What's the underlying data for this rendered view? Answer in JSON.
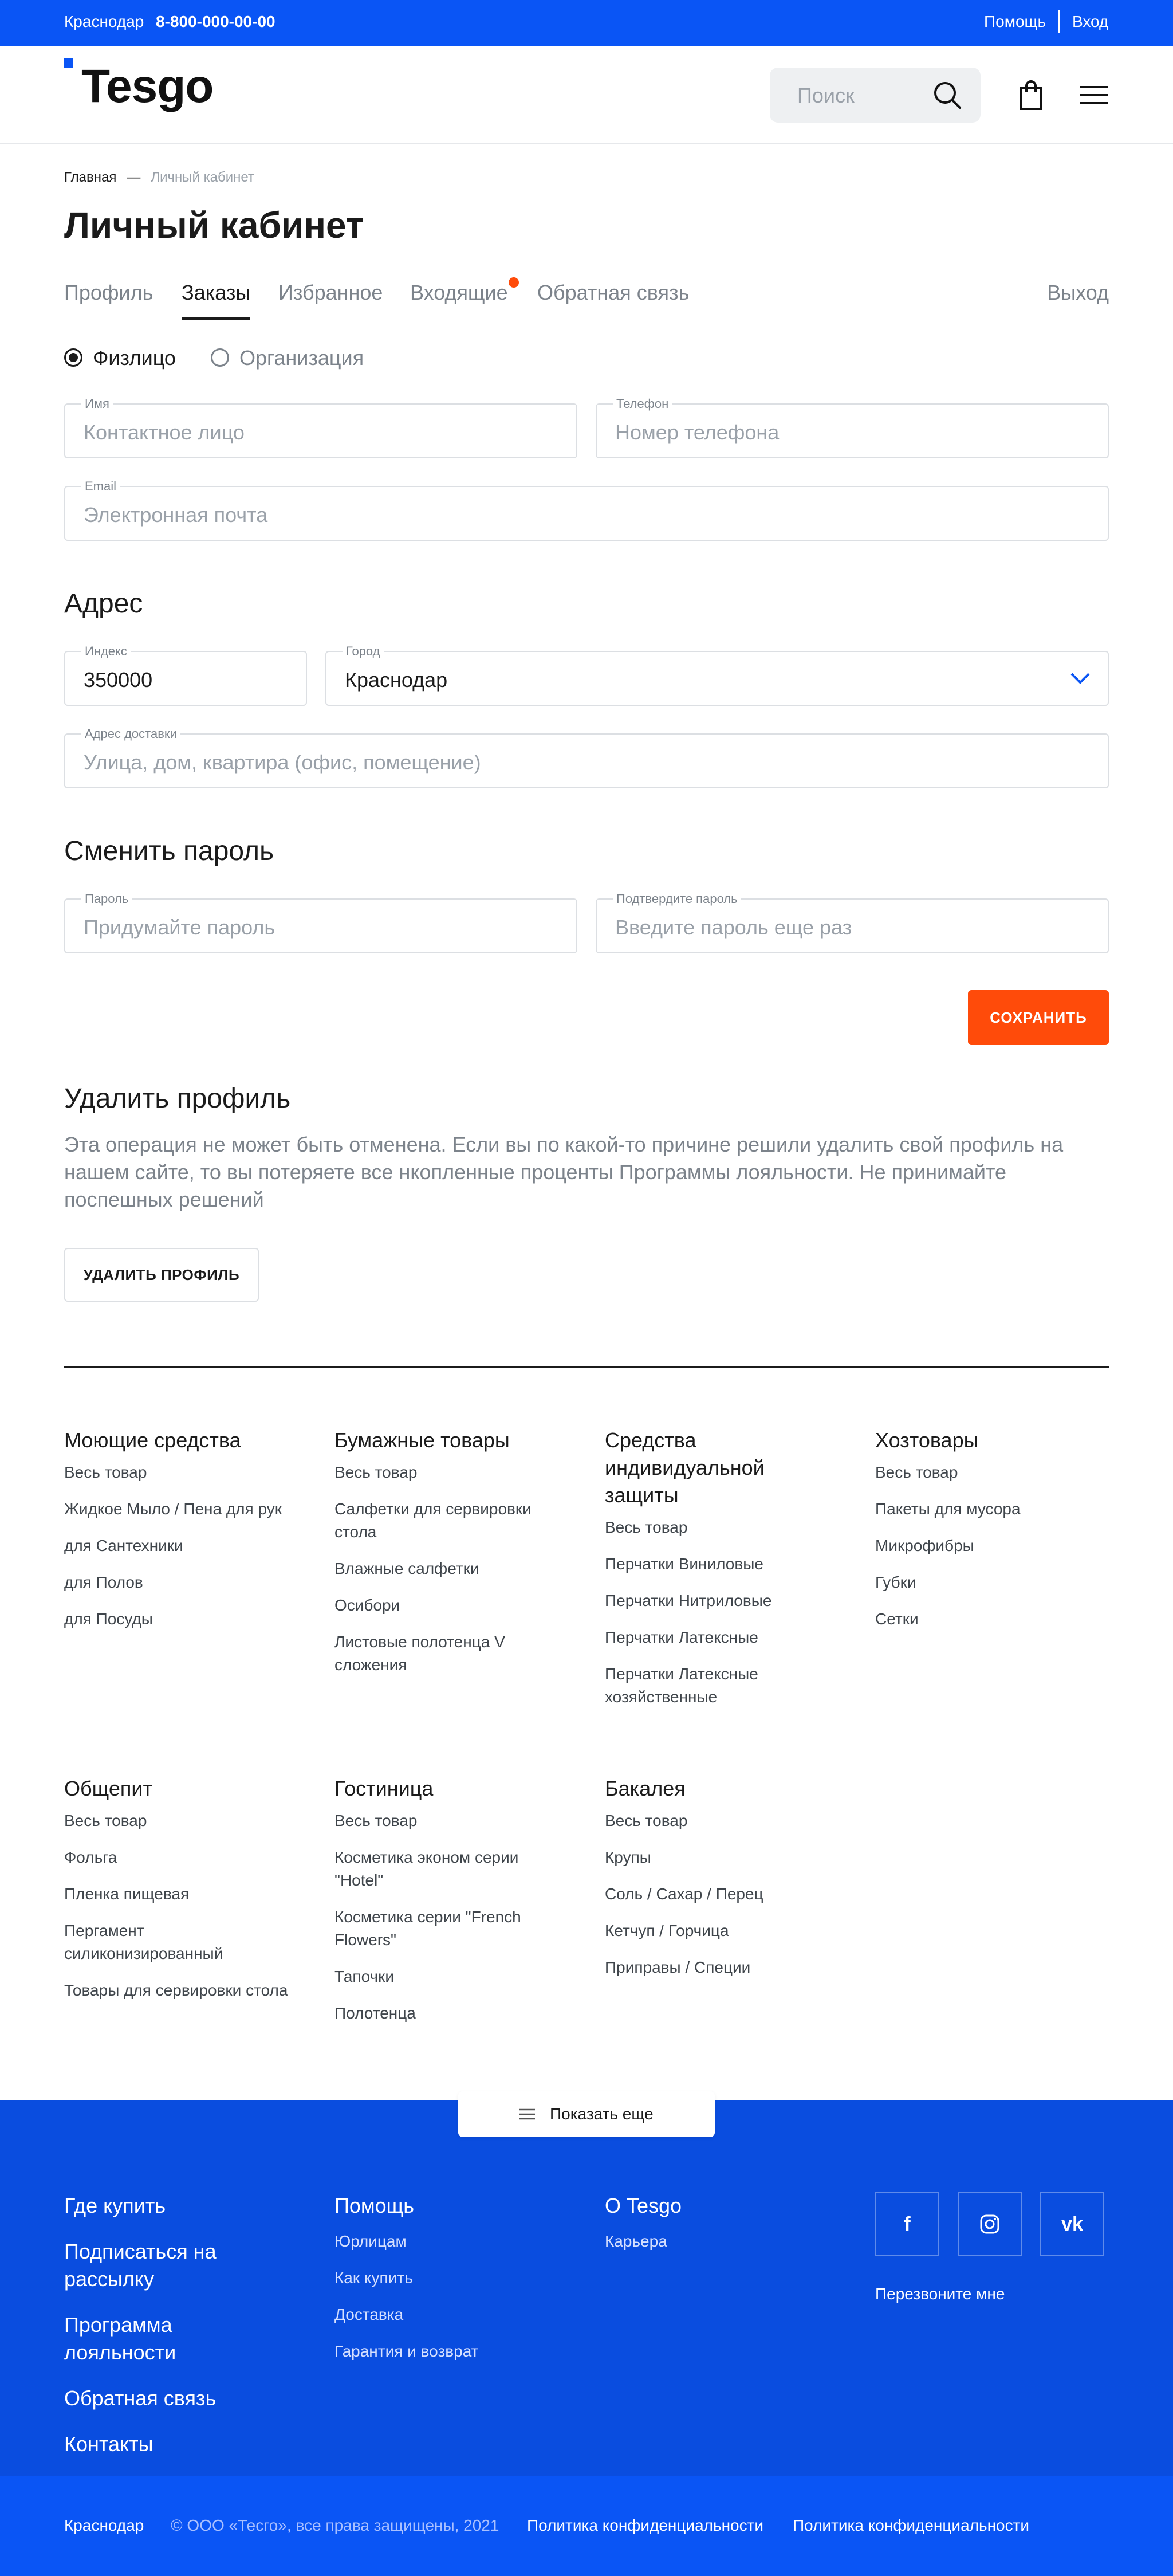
{
  "topbar": {
    "city": "Краснодар",
    "phone": "8-800-000-00-00",
    "help": "Помощь",
    "login": "Вход"
  },
  "header": {
    "logo": "Tesgo",
    "search_placeholder": "Поиск"
  },
  "breadcrumb": {
    "home": "Главная",
    "separator": "—",
    "current": "Личный кабинет"
  },
  "page_title": "Личный кабинет",
  "tabs": [
    "Профиль",
    "Заказы",
    "Избранное",
    "Входящие",
    "Обратная связь"
  ],
  "active_tab": "Заказы",
  "logout": "Выход",
  "person_type": {
    "options": [
      "Физлицо",
      "Организация"
    ],
    "selected": "Физлицо"
  },
  "contact": {
    "name": {
      "label": "Имя",
      "placeholder": "Контактное лицо"
    },
    "phone": {
      "label": "Телефон",
      "placeholder": "Номер телефона"
    },
    "email": {
      "label": "Email",
      "placeholder": "Электронная почта"
    }
  },
  "address": {
    "heading": "Адрес",
    "index": {
      "label": "Индекс",
      "value": "350000"
    },
    "city": {
      "label": "Город",
      "value": "Краснодар"
    },
    "delivery": {
      "label": "Адрес доставки",
      "placeholder": "Улица, дом, квартира (офис, помещение)"
    }
  },
  "password": {
    "heading": "Сменить пароль",
    "new": {
      "label": "Пароль",
      "placeholder": "Придумайте пароль"
    },
    "confirm": {
      "label": "Подтвердите пароль",
      "placeholder": "Введите пароль еще раз"
    }
  },
  "save_label": "СОХРАНИТЬ",
  "delete": {
    "heading": "Удалить профиль",
    "warning": "Эта операция не может быть отменена. Если вы по какой-то причине решили удалить свой профиль на нашем сайте, то вы потеряете все нкопленные проценты Программы лояльности. Не принимайте поспешных решений",
    "button": "УДАЛИТЬ ПРОФИЛЬ"
  },
  "catalog": [
    {
      "title": "Моющие средства",
      "items": [
        "Весь товар",
        "Жидкое Мыло / Пена для рук",
        "для Сантехники",
        "для Полов",
        "для Посуды"
      ]
    },
    {
      "title": "Бумажные товары",
      "items": [
        "Весь товар",
        "Салфетки для сервировки стола",
        "Влажные салфетки",
        "Осибори",
        "Листовые полотенца V сложения"
      ]
    },
    {
      "title": "Средства индивидуальной защиты",
      "items": [
        "Весь товар",
        "Перчатки Виниловые",
        "Перчатки Нитриловые",
        "Перчатки Латексные",
        "Перчатки Латексные хозяйственные"
      ]
    },
    {
      "title": "Хозтовары",
      "items": [
        "Весь товар",
        "Пакеты для мусора",
        "Микрофибры",
        "Губки",
        "Сетки"
      ]
    },
    {
      "title": "Общепит",
      "items": [
        "Весь товар",
        "Фольга",
        "Пленка пищевая",
        "Пергамент силиконизированный",
        "Товары для сервировки стола"
      ]
    },
    {
      "title": "Гостиница",
      "items": [
        "Весь товар",
        "Косметика эконом серии \"Hotel\"",
        "Косметика серии \"French Flowers\"",
        "Тапочки",
        "Полотенца"
      ]
    },
    {
      "title": "Бакалея",
      "items": [
        "Весь товар",
        "Крупы",
        "Соль / Сахар / Перец",
        "Кетчуп / Горчица",
        "Приправы / Специи"
      ]
    }
  ],
  "show_more": "Показать еще",
  "footer": {
    "main_links": [
      "Где купить",
      "Подписаться на рассылку",
      "Программа лояльности",
      "Обратная связь",
      "Контакты"
    ],
    "help": {
      "title": "Помощь",
      "items": [
        "Юрлицам",
        "Как купить",
        "Доставка",
        "Гарантия и возврат"
      ]
    },
    "about": {
      "title": "О Tesgo",
      "items": [
        "Карьера"
      ]
    },
    "social": [
      "f",
      "ig",
      "vk"
    ],
    "callback": "Перезвоните мне"
  },
  "bottom": {
    "city": "Краснодар",
    "copyright": "© ООО «Тесго», все права защищены, 2021",
    "policy1": "Политика конфиденциальности",
    "policy2": "Политика конфиденциальности"
  },
  "colors": {
    "brand_blue": "#0a55f5",
    "footer_blue": "#0a4ddf",
    "accent_orange": "#ff4b0a"
  }
}
